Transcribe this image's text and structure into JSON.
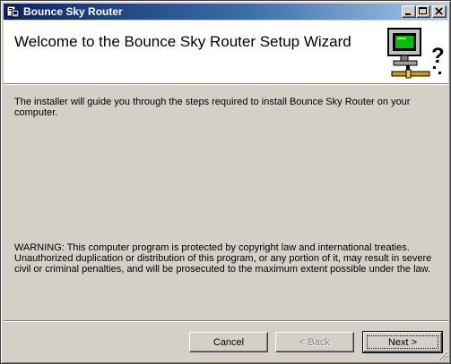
{
  "window": {
    "title": "Bounce Sky Router"
  },
  "header": {
    "title": "Welcome to the Bounce Sky Router Setup Wizard"
  },
  "body": {
    "intro": "The installer will guide you through the steps required to install Bounce Sky Router on your computer.",
    "warning": "WARNING: This computer program is protected by copyright law and international treaties. Unauthorized duplication or distribution of this program, or any portion of it, may result in severe civil or criminal penalties, and will be prosecuted to the maximum extent possible under the law."
  },
  "buttons": {
    "cancel": "Cancel",
    "back": "< Back",
    "next": "Next >"
  },
  "colors": {
    "titlebar_start": "#0a246a",
    "titlebar_end": "#a6caf0",
    "face": "#d4d0c8",
    "monitor_screen": "#00c000"
  },
  "icons": {
    "app": "installer-app-icon",
    "wizard": "computer-network-icon",
    "minimize": "minimize-icon",
    "maximize": "maximize-icon",
    "close": "close-icon"
  }
}
